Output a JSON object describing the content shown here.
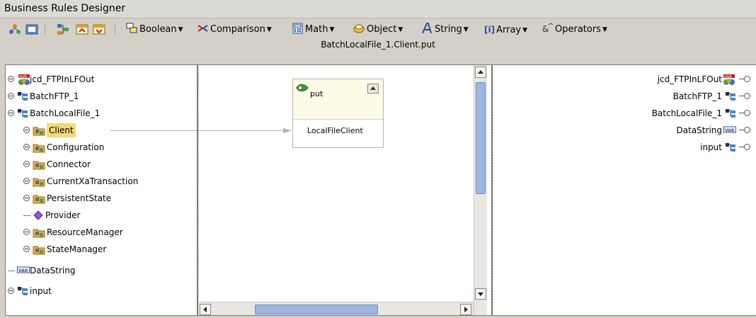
{
  "window": {
    "title": "Business Rules Designer"
  },
  "toolbar": {
    "menus": [
      "Boolean",
      "Comparison",
      "Math",
      "Object",
      "String",
      "Array",
      "Operators"
    ]
  },
  "path": "BatchLocalFile_1.Client.put",
  "left_tree": [
    {
      "label": "jcd_FTPInLFOut",
      "icon": "java-collaboration-icon",
      "expander": true,
      "indent": 0
    },
    {
      "label": "BatchFTP_1",
      "icon": "component-icon",
      "expander": true,
      "indent": 0
    },
    {
      "label": "BatchLocalFile_1",
      "icon": "component-icon",
      "expander": true,
      "indent": 0
    },
    {
      "label": "Client",
      "icon": "class-folder-icon",
      "expander": true,
      "indent": 1,
      "selected": true
    },
    {
      "label": "Configuration",
      "icon": "class-folder-icon",
      "expander": true,
      "indent": 1
    },
    {
      "label": "Connector",
      "icon": "class-folder-icon",
      "expander": true,
      "indent": 1
    },
    {
      "label": "CurrentXaTransaction",
      "icon": "class-folder-icon",
      "expander": true,
      "indent": 1
    },
    {
      "label": "PersistentState",
      "icon": "class-folder-icon",
      "expander": true,
      "indent": 1
    },
    {
      "label": "Provider",
      "icon": "diamond-icon",
      "expander": false,
      "indent": 1
    },
    {
      "label": "ResourceManager",
      "icon": "class-folder-icon",
      "expander": true,
      "indent": 1
    },
    {
      "label": "StateManager",
      "icon": "class-folder-icon",
      "expander": true,
      "indent": 1
    },
    {
      "label": "DataString",
      "icon": "variable-icon",
      "expander": false,
      "indent": 0
    },
    {
      "label": "input",
      "icon": "component-icon",
      "expander": true,
      "indent": 0
    }
  ],
  "method_node": {
    "title": "put",
    "param": "LocalFileClient"
  },
  "right_tree": [
    {
      "label": "jcd_FTPInLFOut",
      "icon": "java-collaboration-icon"
    },
    {
      "label": "BatchFTP_1",
      "icon": "component-icon"
    },
    {
      "label": "BatchLocalFile_1",
      "icon": "component-icon"
    },
    {
      "label": "DataString",
      "icon": "variable-icon"
    },
    {
      "label": "input",
      "icon": "component-icon"
    }
  ],
  "colors": {
    "selection": "#f5d77a",
    "scroll_thumb": "#9db7e0",
    "node_header": "#fdfbe6"
  }
}
